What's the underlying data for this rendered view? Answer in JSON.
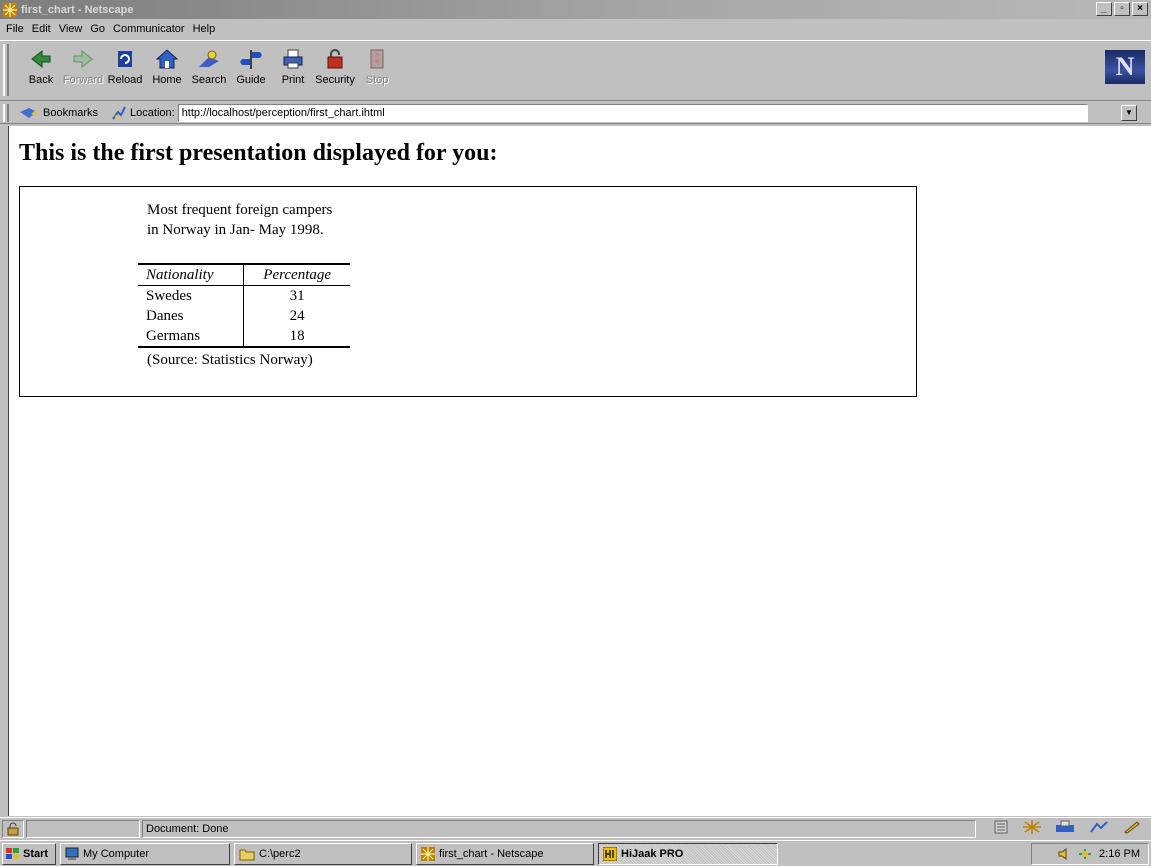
{
  "window": {
    "title": "first_chart - Netscape",
    "min": "_",
    "max": "▫",
    "close": "×"
  },
  "menu": [
    "File",
    "Edit",
    "View",
    "Go",
    "Communicator",
    "Help"
  ],
  "toolbar": {
    "back": "Back",
    "forward": "Forward",
    "reload": "Reload",
    "home": "Home",
    "search": "Search",
    "guide": "Guide",
    "print": "Print",
    "security": "Security",
    "stop": "Stop",
    "logo": "N"
  },
  "location": {
    "bookmarks": "Bookmarks",
    "label": "Location:",
    "url": "http://localhost/perception/first_chart.ihtml"
  },
  "page": {
    "heading": "This is the first presentation displayed for you:",
    "caption_line1": "Most frequent foreign campers",
    "caption_line2": "in Norway in Jan- May 1998.",
    "source": "(Source: Statistics Norway)"
  },
  "chart_data": {
    "type": "table",
    "columns": [
      "Nationality",
      "Percentage"
    ],
    "rows": [
      [
        "Swedes",
        "31"
      ],
      [
        "Danes",
        "24"
      ],
      [
        "Germans",
        "18"
      ]
    ]
  },
  "status": {
    "text": "Document: Done"
  },
  "taskbar": {
    "start": "Start",
    "tasks": [
      "My Computer",
      "C:\\perc2",
      "first_chart - Netscape",
      "HiJaak PRO"
    ],
    "clock": "2:16 PM"
  }
}
